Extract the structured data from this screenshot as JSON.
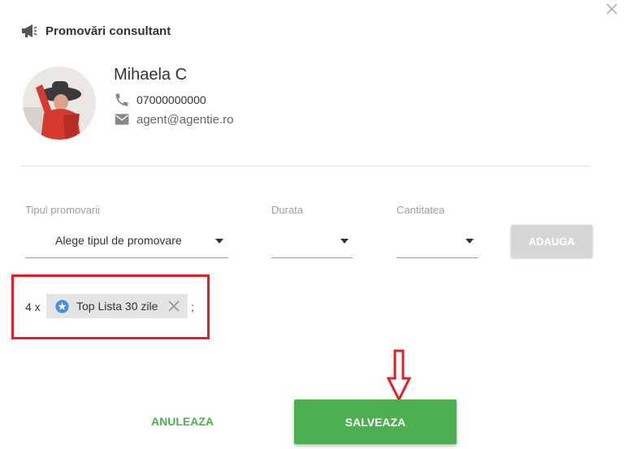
{
  "dialog": {
    "title": "Promovări consultant",
    "close_icon": "close-icon",
    "header_icon": "megaphone-icon"
  },
  "agent": {
    "name": "Mihaela C",
    "phone": "07000000000",
    "email": "agent@agentie.ro",
    "phone_icon": "phone-icon",
    "email_icon": "email-icon"
  },
  "form": {
    "type_label": "Tipul promovarii",
    "type_value": "Alege tipul de promovare",
    "duration_label": "Durata",
    "duration_value": "",
    "quantity_label": "Cantitatea",
    "quantity_value": "",
    "add_label": "ADAUGA"
  },
  "selected_promotions": [
    {
      "quantity_text": "4 x",
      "label": "Top Lista 30 zile",
      "icon": "star-icon",
      "separator": ";"
    }
  ],
  "actions": {
    "cancel_label": "ANULEAZA",
    "save_label": "SALVEAZA"
  },
  "colors": {
    "accent_green": "#4caf50",
    "annotation_red": "#e21f26",
    "disabled_gray": "#d6d6d6",
    "chip_blue": "#4a90e2"
  }
}
